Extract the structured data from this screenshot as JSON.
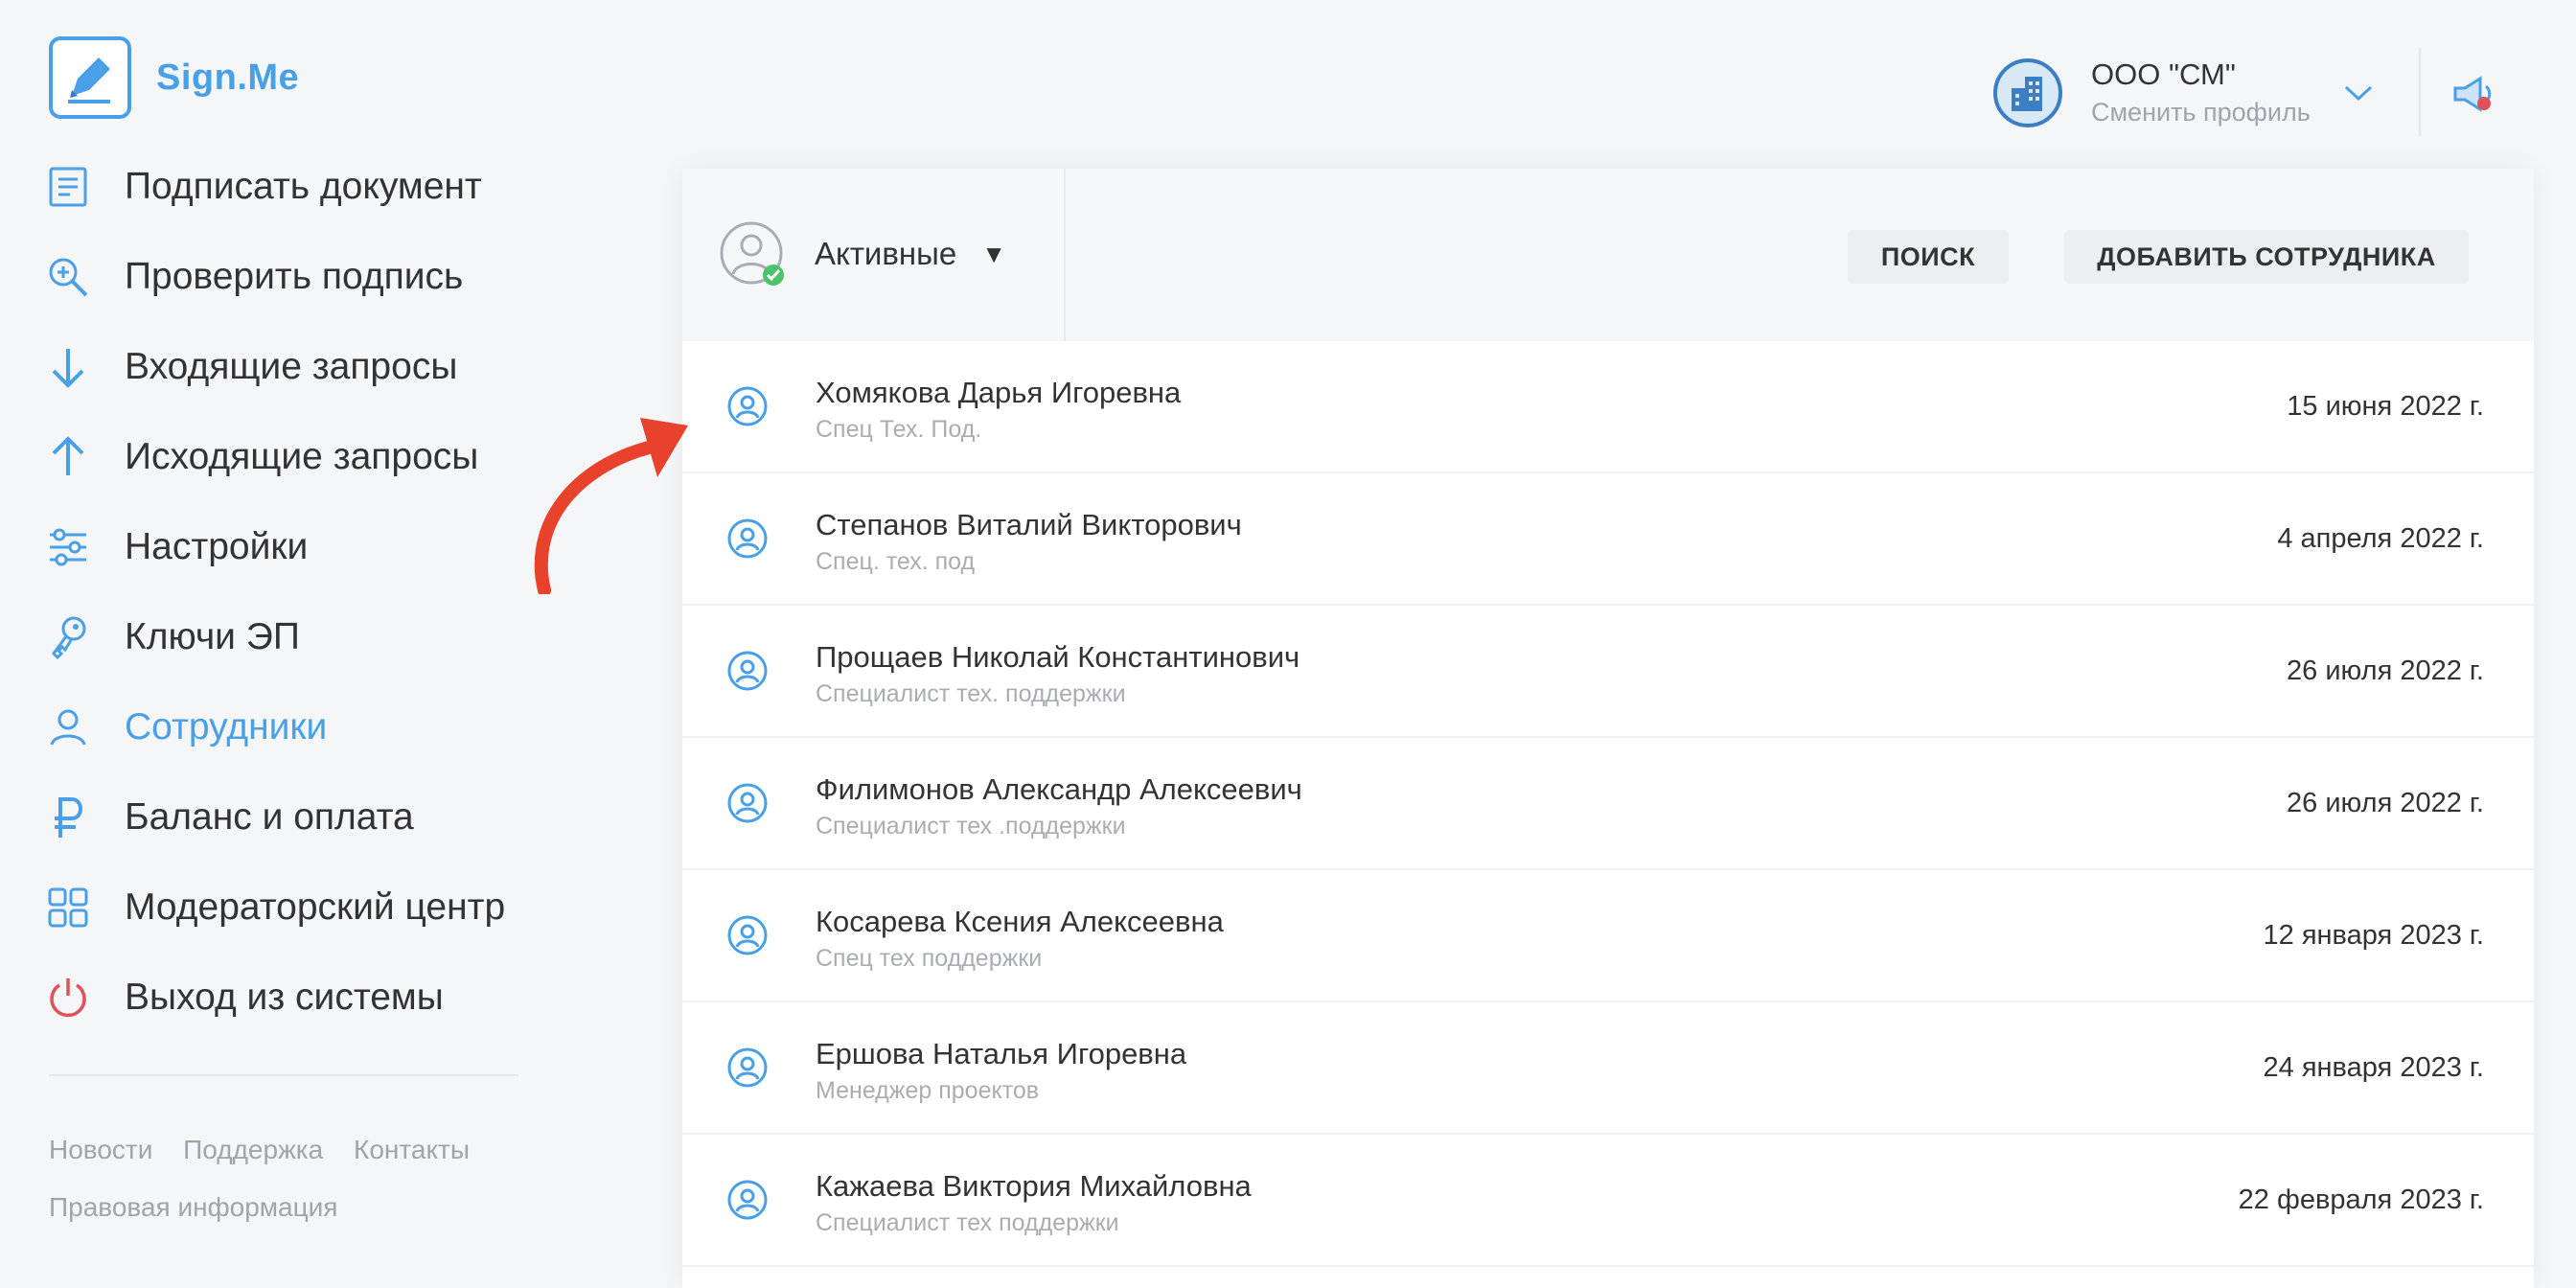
{
  "app": {
    "logo_text": "Sign.Me"
  },
  "sidebar": {
    "items": [
      {
        "label": "Подписать документ",
        "icon": "document-icon"
      },
      {
        "label": "Проверить подпись",
        "icon": "search-check-icon"
      },
      {
        "label": "Входящие запросы",
        "icon": "arrow-down-icon"
      },
      {
        "label": "Исходящие запросы",
        "icon": "arrow-up-icon"
      },
      {
        "label": "Настройки",
        "icon": "sliders-icon"
      },
      {
        "label": "Ключи ЭП",
        "icon": "key-icon"
      },
      {
        "label": "Сотрудники",
        "icon": "user-icon",
        "active": true
      },
      {
        "label": "Баланс и оплата",
        "icon": "ruble-icon"
      },
      {
        "label": "Модераторский центр",
        "icon": "grid-icon"
      },
      {
        "label": "Выход из системы",
        "icon": "power-icon"
      }
    ],
    "footer_links": [
      "Новости",
      "Поддержка",
      "Контакты",
      "Правовая информация"
    ]
  },
  "header": {
    "org_name": "ООО \"СМ\"",
    "switch_profile": "Сменить профиль"
  },
  "toolbar": {
    "filter_label": "Активные",
    "search_button": "ПОИСК",
    "add_button": "ДОБАВИТЬ СОТРУДНИКА"
  },
  "employees": [
    {
      "name": "Хомякова Дарья Игоревна",
      "role": "Спец Тех. Под.",
      "date": "15 июня 2022 г."
    },
    {
      "name": "Степанов Виталий Викторович",
      "role": "Спец. тех. под",
      "date": "4 апреля 2022 г."
    },
    {
      "name": "Прощаев Николай Константинович",
      "role": "Специалист тех. поддержки",
      "date": "26 июля 2022 г."
    },
    {
      "name": "Филимонов Александр Алексеевич",
      "role": "Специалист тех .поддержки",
      "date": "26 июля 2022 г."
    },
    {
      "name": "Косарева Ксения Алексеевна",
      "role": "Спец тех поддержки",
      "date": "12 января 2023 г."
    },
    {
      "name": "Ершова Наталья Игоревна",
      "role": "Менеджер проектов",
      "date": "24 января 2023 г."
    },
    {
      "name": "Кажаева Виктория Михайловна",
      "role": "Специалист тех поддержки",
      "date": "22 февраля 2023 г."
    }
  ],
  "colors": {
    "accent": "#4aa0e6",
    "danger": "#e0525a",
    "annotation_arrow": "#e8412c",
    "success": "#4cc36b"
  }
}
